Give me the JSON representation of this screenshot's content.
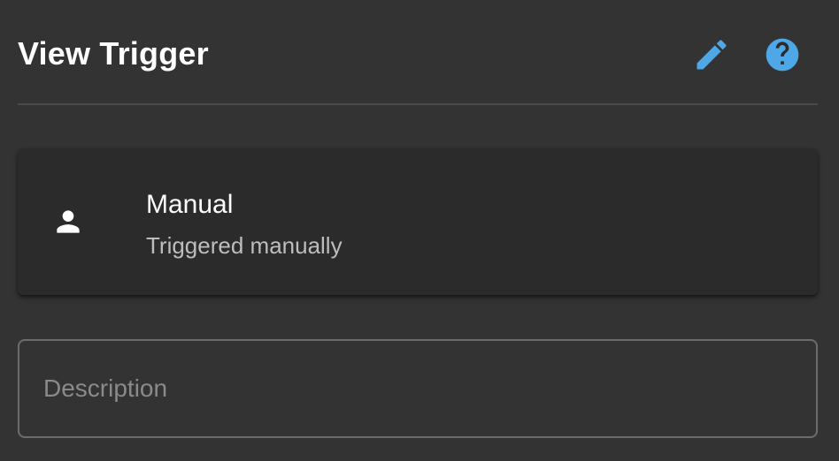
{
  "header": {
    "title": "View Trigger"
  },
  "trigger": {
    "title": "Manual",
    "subtitle": "Triggered manually",
    "icon": "person-icon"
  },
  "description": {
    "placeholder": "Description",
    "value": ""
  },
  "colors": {
    "background": "#333333",
    "card": "#2b2b2b",
    "accent": "#4ea7e6",
    "divider": "#4a4a4a"
  },
  "icons": {
    "edit": "pencil-icon",
    "help": "help-circle-icon"
  }
}
